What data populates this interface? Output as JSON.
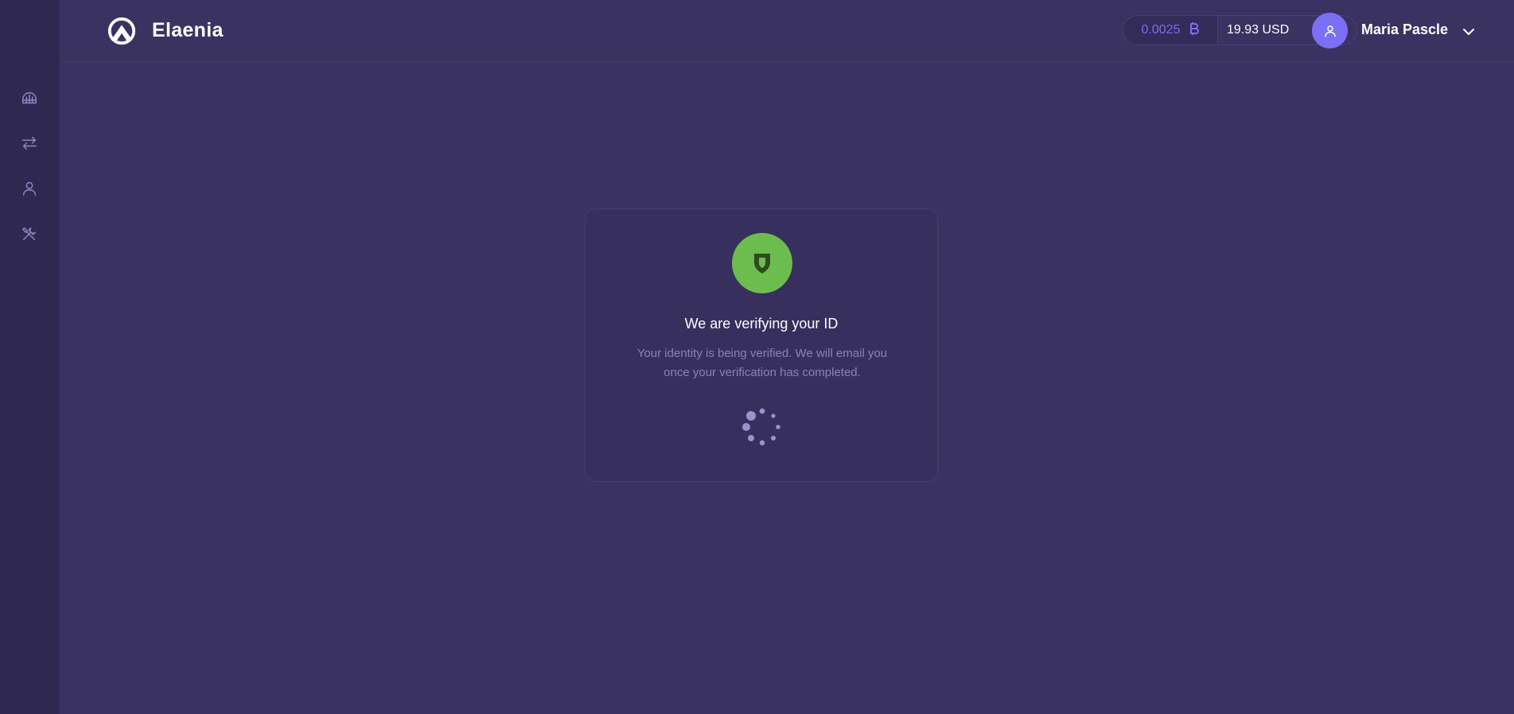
{
  "header": {
    "brand": "Elaenia",
    "balance": {
      "crypto_amount": "0.0025",
      "crypto_icon": "bitcoin-icon",
      "fiat_amount": "19.93 USD"
    },
    "user": {
      "name": "Maria Pascle",
      "avatar_icon": "user-icon"
    }
  },
  "sidebar": {
    "items": [
      {
        "icon": "dashboard-icon"
      },
      {
        "icon": "exchange-icon"
      },
      {
        "icon": "user-icon"
      },
      {
        "icon": "tools-icon"
      }
    ]
  },
  "verification": {
    "icon": "shield-icon",
    "title": "We are verifying your ID",
    "description": "Your identity is being verified. We will email you once your verification has completed.",
    "status": "loading"
  },
  "colors": {
    "background": "#3a3260",
    "sidebar": "#2f2850",
    "accent": "#7b6ff5",
    "success": "#6dbd4e",
    "muted_text": "#8b83b8"
  }
}
